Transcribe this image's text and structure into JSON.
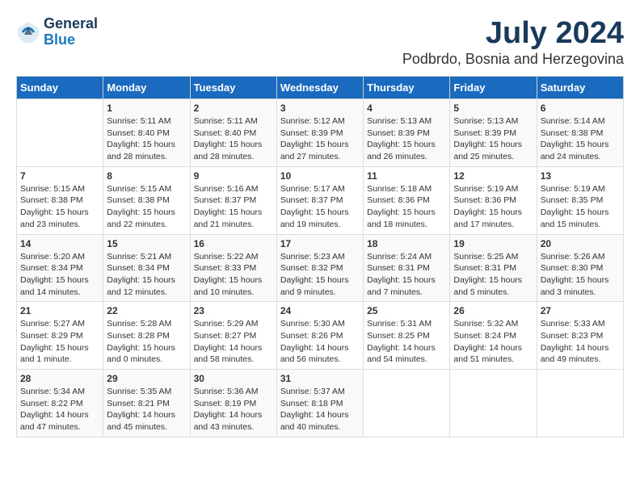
{
  "logo": {
    "general": "General",
    "blue": "Blue"
  },
  "title": "July 2024",
  "subtitle": "Podbrdo, Bosnia and Herzegovina",
  "days_header": [
    "Sunday",
    "Monday",
    "Tuesday",
    "Wednesday",
    "Thursday",
    "Friday",
    "Saturday"
  ],
  "weeks": [
    [
      {
        "day": "",
        "info": ""
      },
      {
        "day": "1",
        "info": "Sunrise: 5:11 AM\nSunset: 8:40 PM\nDaylight: 15 hours and 28 minutes."
      },
      {
        "day": "2",
        "info": "Sunrise: 5:11 AM\nSunset: 8:40 PM\nDaylight: 15 hours and 28 minutes."
      },
      {
        "day": "3",
        "info": "Sunrise: 5:12 AM\nSunset: 8:39 PM\nDaylight: 15 hours and 27 minutes."
      },
      {
        "day": "4",
        "info": "Sunrise: 5:13 AM\nSunset: 8:39 PM\nDaylight: 15 hours and 26 minutes."
      },
      {
        "day": "5",
        "info": "Sunrise: 5:13 AM\nSunset: 8:39 PM\nDaylight: 15 hours and 25 minutes."
      },
      {
        "day": "6",
        "info": "Sunrise: 5:14 AM\nSunset: 8:38 PM\nDaylight: 15 hours and 24 minutes."
      }
    ],
    [
      {
        "day": "7",
        "info": "Sunrise: 5:15 AM\nSunset: 8:38 PM\nDaylight: 15 hours and 23 minutes."
      },
      {
        "day": "8",
        "info": "Sunrise: 5:15 AM\nSunset: 8:38 PM\nDaylight: 15 hours and 22 minutes."
      },
      {
        "day": "9",
        "info": "Sunrise: 5:16 AM\nSunset: 8:37 PM\nDaylight: 15 hours and 21 minutes."
      },
      {
        "day": "10",
        "info": "Sunrise: 5:17 AM\nSunset: 8:37 PM\nDaylight: 15 hours and 19 minutes."
      },
      {
        "day": "11",
        "info": "Sunrise: 5:18 AM\nSunset: 8:36 PM\nDaylight: 15 hours and 18 minutes."
      },
      {
        "day": "12",
        "info": "Sunrise: 5:19 AM\nSunset: 8:36 PM\nDaylight: 15 hours and 17 minutes."
      },
      {
        "day": "13",
        "info": "Sunrise: 5:19 AM\nSunset: 8:35 PM\nDaylight: 15 hours and 15 minutes."
      }
    ],
    [
      {
        "day": "14",
        "info": "Sunrise: 5:20 AM\nSunset: 8:34 PM\nDaylight: 15 hours and 14 minutes."
      },
      {
        "day": "15",
        "info": "Sunrise: 5:21 AM\nSunset: 8:34 PM\nDaylight: 15 hours and 12 minutes."
      },
      {
        "day": "16",
        "info": "Sunrise: 5:22 AM\nSunset: 8:33 PM\nDaylight: 15 hours and 10 minutes."
      },
      {
        "day": "17",
        "info": "Sunrise: 5:23 AM\nSunset: 8:32 PM\nDaylight: 15 hours and 9 minutes."
      },
      {
        "day": "18",
        "info": "Sunrise: 5:24 AM\nSunset: 8:31 PM\nDaylight: 15 hours and 7 minutes."
      },
      {
        "day": "19",
        "info": "Sunrise: 5:25 AM\nSunset: 8:31 PM\nDaylight: 15 hours and 5 minutes."
      },
      {
        "day": "20",
        "info": "Sunrise: 5:26 AM\nSunset: 8:30 PM\nDaylight: 15 hours and 3 minutes."
      }
    ],
    [
      {
        "day": "21",
        "info": "Sunrise: 5:27 AM\nSunset: 8:29 PM\nDaylight: 15 hours and 1 minute."
      },
      {
        "day": "22",
        "info": "Sunrise: 5:28 AM\nSunset: 8:28 PM\nDaylight: 15 hours and 0 minutes."
      },
      {
        "day": "23",
        "info": "Sunrise: 5:29 AM\nSunset: 8:27 PM\nDaylight: 14 hours and 58 minutes."
      },
      {
        "day": "24",
        "info": "Sunrise: 5:30 AM\nSunset: 8:26 PM\nDaylight: 14 hours and 56 minutes."
      },
      {
        "day": "25",
        "info": "Sunrise: 5:31 AM\nSunset: 8:25 PM\nDaylight: 14 hours and 54 minutes."
      },
      {
        "day": "26",
        "info": "Sunrise: 5:32 AM\nSunset: 8:24 PM\nDaylight: 14 hours and 51 minutes."
      },
      {
        "day": "27",
        "info": "Sunrise: 5:33 AM\nSunset: 8:23 PM\nDaylight: 14 hours and 49 minutes."
      }
    ],
    [
      {
        "day": "28",
        "info": "Sunrise: 5:34 AM\nSunset: 8:22 PM\nDaylight: 14 hours and 47 minutes."
      },
      {
        "day": "29",
        "info": "Sunrise: 5:35 AM\nSunset: 8:21 PM\nDaylight: 14 hours and 45 minutes."
      },
      {
        "day": "30",
        "info": "Sunrise: 5:36 AM\nSunset: 8:19 PM\nDaylight: 14 hours and 43 minutes."
      },
      {
        "day": "31",
        "info": "Sunrise: 5:37 AM\nSunset: 8:18 PM\nDaylight: 14 hours and 40 minutes."
      },
      {
        "day": "",
        "info": ""
      },
      {
        "day": "",
        "info": ""
      },
      {
        "day": "",
        "info": ""
      }
    ]
  ]
}
